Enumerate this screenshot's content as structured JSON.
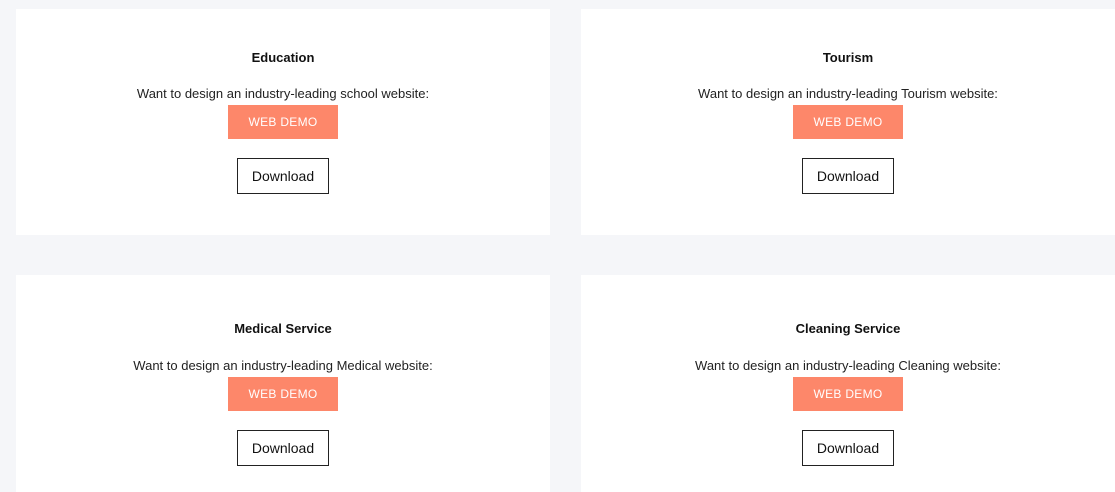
{
  "cards": [
    {
      "title": "Education",
      "description": "Want to design an industry-leading school website:",
      "demo_label": "WEB DEMO",
      "download_label": "Download"
    },
    {
      "title": "Tourism",
      "description": "Want to design an industry-leading Tourism website:",
      "demo_label": "WEB DEMO",
      "download_label": "Download"
    },
    {
      "title": "Medical Service",
      "description": "Want to design an industry-leading Medical website:",
      "demo_label": "WEB DEMO",
      "download_label": "Download"
    },
    {
      "title": "Cleaning Service",
      "description": "Want to design an industry-leading Cleaning website:",
      "demo_label": "WEB DEMO",
      "download_label": "Download"
    }
  ],
  "colors": {
    "page_background": "#f5f6f9",
    "card_background": "#ffffff",
    "demo_button": "#fd876a",
    "demo_button_text": "#ffffff",
    "download_border": "#222222"
  }
}
